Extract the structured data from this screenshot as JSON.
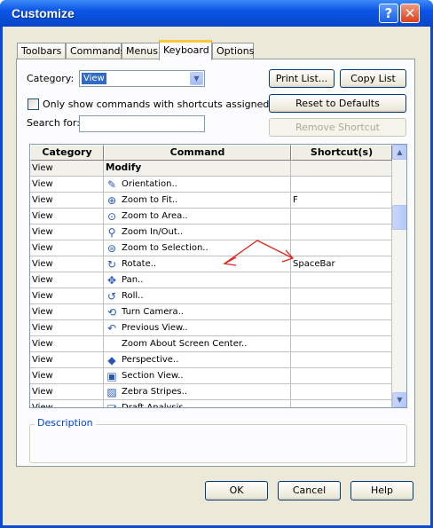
{
  "window": {
    "title": "Customize",
    "help_glyph": "?",
    "close_glyph": "✕"
  },
  "tabs": [
    {
      "label": "Toolbars",
      "active": false
    },
    {
      "label": "Commands",
      "active": false
    },
    {
      "label": "Menus",
      "active": false
    },
    {
      "label": "Keyboard",
      "active": true
    },
    {
      "label": "Options",
      "active": false
    }
  ],
  "form": {
    "category_label": "Category:",
    "category_value": "View",
    "only_shortcuts_label": "Only show commands with shortcuts assigned",
    "only_shortcuts_checked": false,
    "search_label": "Search for:",
    "search_value": ""
  },
  "buttons": {
    "print_list": "Print List...",
    "copy_list": "Copy List",
    "reset_defaults": "Reset to Defaults",
    "remove_shortcut": "Remove Shortcut",
    "ok": "OK",
    "cancel": "Cancel",
    "help": "Help"
  },
  "table": {
    "headers": [
      "Category",
      "Command",
      "Shortcut(s)"
    ],
    "rows": [
      {
        "category": "View",
        "command": "Modify",
        "shortcut": "",
        "icon": "",
        "group": true
      },
      {
        "category": "View",
        "command": "Orientation..",
        "shortcut": "",
        "icon": "orientation-icon"
      },
      {
        "category": "View",
        "command": "Zoom to Fit..",
        "shortcut": "F",
        "icon": "zoom-to-fit-icon"
      },
      {
        "category": "View",
        "command": "Zoom to Area..",
        "shortcut": "",
        "icon": "zoom-to-area-icon"
      },
      {
        "category": "View",
        "command": "Zoom In/Out..",
        "shortcut": "",
        "icon": "zoom-in-out-icon"
      },
      {
        "category": "View",
        "command": "Zoom to Selection..",
        "shortcut": "",
        "icon": "zoom-to-selection-icon"
      },
      {
        "category": "View",
        "command": "Rotate..",
        "shortcut": "SpaceBar",
        "icon": "rotate-icon"
      },
      {
        "category": "View",
        "command": "Pan..",
        "shortcut": "",
        "icon": "pan-icon"
      },
      {
        "category": "View",
        "command": "Roll..",
        "shortcut": "",
        "icon": "roll-icon"
      },
      {
        "category": "View",
        "command": "Turn Camera..",
        "shortcut": "",
        "icon": "turn-camera-icon"
      },
      {
        "category": "View",
        "command": "Previous View..",
        "shortcut": "",
        "icon": "previous-view-icon"
      },
      {
        "category": "View",
        "command": "Zoom About Screen Center..",
        "shortcut": "",
        "icon": ""
      },
      {
        "category": "View",
        "command": "Perspective..",
        "shortcut": "",
        "icon": "perspective-icon"
      },
      {
        "category": "View",
        "command": "Section View..",
        "shortcut": "",
        "icon": "section-view-icon"
      },
      {
        "category": "View",
        "command": "Zebra Stripes..",
        "shortcut": "",
        "icon": "zebra-stripes-icon"
      },
      {
        "category": "View",
        "command": "Draft Analysis..",
        "shortcut": "",
        "icon": "draft-analysis-icon"
      }
    ]
  },
  "description": {
    "label": "Description"
  },
  "colors": {
    "title_bar": "#0a55e6",
    "dialog_bg": "#ece9d8",
    "selection": "#316ac5",
    "annotation": "#e0241b",
    "group_title": "#0046d5"
  }
}
